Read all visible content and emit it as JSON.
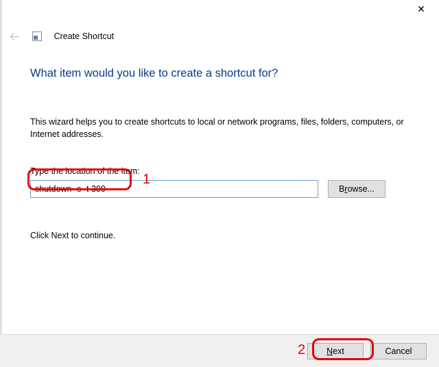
{
  "window": {
    "title": "Create Shortcut"
  },
  "content": {
    "heading": "What item would you like to create a shortcut for?",
    "description": "This wizard helps you to create shortcuts to local or network programs, files, folders, computers, or Internet addresses.",
    "field_label": "Type the location of the item:",
    "path_value": "shutdown -s -t 300",
    "browse_label": "Browse...",
    "continue_text": "Click Next to continue."
  },
  "footer": {
    "next_label": "Next",
    "cancel_label": "Cancel"
  },
  "annotations": {
    "one": "1",
    "two": "2"
  }
}
